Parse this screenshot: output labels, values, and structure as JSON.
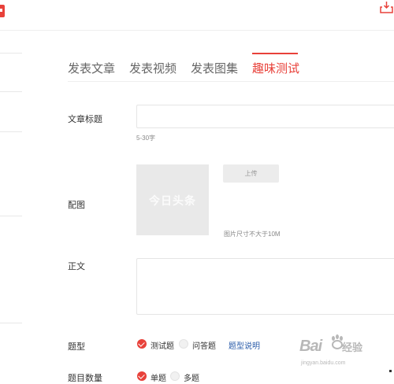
{
  "tabs": [
    {
      "label": "发表文章"
    },
    {
      "label": "发表视频"
    },
    {
      "label": "发表图集"
    },
    {
      "label": "趣味测试"
    }
  ],
  "active_tab": "趣味测试",
  "form": {
    "title_label": "文章标题",
    "title_hint": "5-30字",
    "cover_label": "配图",
    "cover_placeholder_logo": "今日头条",
    "upload_button": "上传",
    "cover_hint": "图片尺寸不大于10M",
    "body_label": "正文",
    "question_type_label": "题型",
    "question_type_options": [
      {
        "label": "测试题",
        "checked": true
      },
      {
        "label": "问答题",
        "checked": false
      }
    ],
    "question_type_help_link": "题型说明",
    "question_count_label": "题目数量",
    "question_count_options": [
      {
        "label": "单题",
        "checked": true
      },
      {
        "label": "多题",
        "checked": false
      }
    ]
  },
  "watermark": {
    "text_bai": "Bai",
    "text_jy": "经验",
    "url": "jingyan.baidu.com"
  },
  "colors": {
    "accent": "#e8413a",
    "link": "#2a5caa"
  },
  "icons": {
    "top_right": "inbox-download-icon"
  }
}
